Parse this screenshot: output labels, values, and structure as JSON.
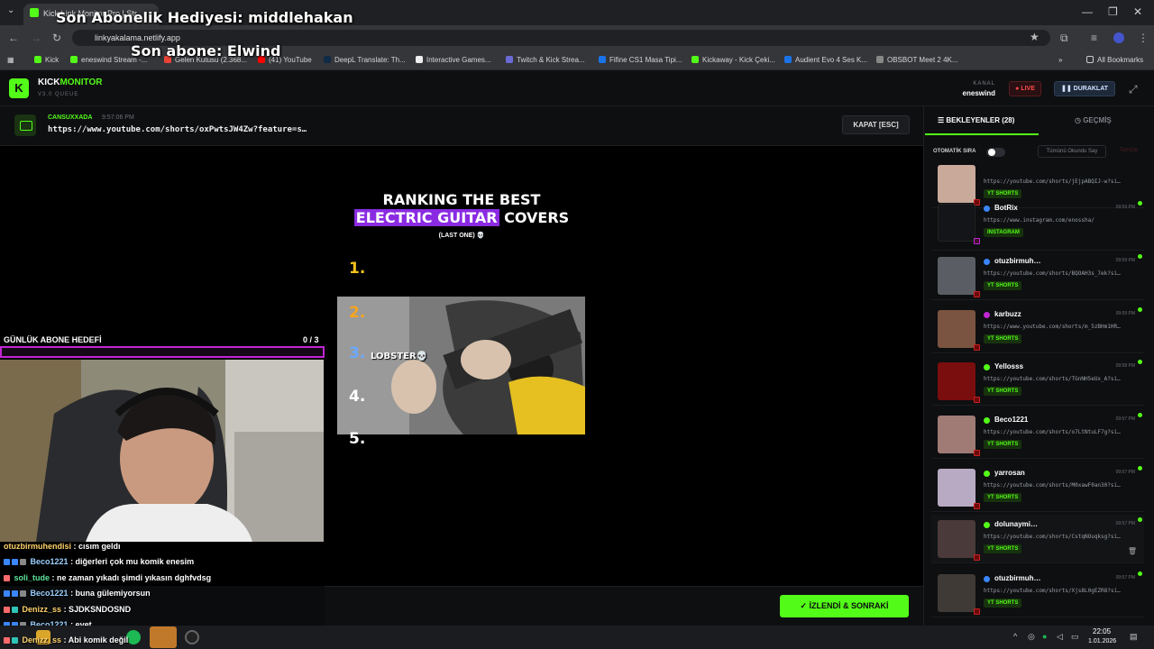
{
  "browser": {
    "tab_title": "Kick Link Monitor Pro | Str",
    "url": "linkyakalama.netlify.app",
    "bookmarks": [
      "Kick",
      "eneswind Stream -...",
      "Gelen Kutusu (2.368...",
      "(41) YouTube",
      "DeepL Translate: Th...",
      "Interactive Games...",
      "Twitch & Kick Strea...",
      "Fifine CS1 Masa Tipi...",
      "Kickaway - Kick Çeki...",
      "Audient Evo 4 Ses K...",
      "OBSBOT Meet 2 4K..."
    ],
    "all_bookmarks": "All Bookmarks"
  },
  "overlay": {
    "gift": "Son Abonelik Hediyesi: middlehakan",
    "subscriber": "Son abone: Elwind"
  },
  "app": {
    "logo_letter": "K",
    "brand_kick": "KICK",
    "brand_monitor": "MONITOR",
    "version": "V3.0 QUEUE",
    "kanal_label": "KANAL",
    "kanal_name": "eneswind",
    "live": "LIVE",
    "pause": "DURAKLAT"
  },
  "now_playing": {
    "user": "CANSUXXADA",
    "time": "9:57:06 PM",
    "url": "https://www.youtube.com/shorts/oxPwtsJW4Zw?feature=s…",
    "close_label": "KAPAT [ESC]"
  },
  "video": {
    "title_line1": "RANKING THE BEST",
    "title_highlight": "ELECTRIC GUITAR",
    "title_rest": "COVERS",
    "subtitle": "(LAST ONE) 💀",
    "ranks": [
      "1.",
      "2.",
      "3.",
      "4.",
      "5."
    ],
    "lobster": "LOBSTER💀"
  },
  "goal": {
    "label": "GÜNLÜK ABONE HEDEFİ",
    "count": "0  / 3",
    "progress": 0
  },
  "chat": [
    {
      "user": "otuzbirmuhendisi",
      "msg": ": cısım geldı"
    },
    {
      "user": "Beco1221",
      "msg": ": diğerleri çok mu komik enesim"
    },
    {
      "user": "soli_tude",
      "msg": ": ne zaman yıkadı şimdi yıkasın dghfvdsg"
    },
    {
      "user": "Beco1221",
      "msg": ": buna gülemiyorsun"
    },
    {
      "user": "Denizz_ss",
      "msg": ": SJDKSNDOSND"
    },
    {
      "user": "Beco1221",
      "msg": ": evet"
    },
    {
      "user": "Denizz_ss",
      "msg": ": Abi komik değil"
    }
  ],
  "next_button": "İZLENDİ & SONRAKİ",
  "panel": {
    "tab_queue": "BEKLEYENLER (28)",
    "tab_history": "GEÇMİŞ",
    "auto_label": "OTOMATİK SIRA",
    "mark_read": "Tümünü Okundu Say",
    "clear": "Temizle",
    "items": [
      {
        "user": "",
        "time": "",
        "url": "https://youtube.com/shorts/jEjpABQIJ-w?si…",
        "tag": "YT SHORTS",
        "color": "#c9a99a"
      },
      {
        "user": "BotRix",
        "time": "09:59 PM",
        "url": "https://www.instagram.com/enossha/",
        "tag": "INSTAGRAM",
        "color": "#1a1b1e"
      },
      {
        "user": "otuzbirmuh…",
        "time": "09:59 PM",
        "url": "https://youtube.com/shorts/BQOAH3s_7ek?si…",
        "tag": "YT SHORTS",
        "color": "#5a5d63"
      },
      {
        "user": "karbuzz",
        "time": "09:59 PM",
        "url": "https://www.youtube.com/shorts/m_5zBHm1HR…",
        "tag": "YT SHORTS",
        "color": "#7a5440"
      },
      {
        "user": "Yellosss",
        "time": "09:58 PM",
        "url": "https://youtube.com/shorts/TGnNH5eUx_A?si…",
        "tag": "YT SHORTS",
        "color": "#7a0d0d"
      },
      {
        "user": "Beco1221",
        "time": "09:57 PM",
        "url": "https://youtube.com/shorts/o7LtNtuLF7g?si…",
        "tag": "YT SHORTS",
        "color": "#a07a75"
      },
      {
        "user": "yarrosan",
        "time": "09:57 PM",
        "url": "https://youtube.com/shorts/M0xawF0an30?si…",
        "tag": "YT SHORTS",
        "color": "#b9aac4"
      },
      {
        "user": "dolunaymi…",
        "time": "09:57 PM",
        "url": "https://youtube.com/shorts/CstqNOuqksg?si…",
        "tag": "YT SHORTS",
        "color": "#4a3a3a"
      },
      {
        "user": "otuzbirmuh…",
        "time": "09:57 PM",
        "url": "https://youtube.com/shorts/Xjs8L0gEZR8?si…",
        "tag": "YT SHORTS",
        "color": "#3f3a36"
      }
    ]
  },
  "taskbar": {
    "time": "22:05",
    "date": "1.01.2026"
  }
}
